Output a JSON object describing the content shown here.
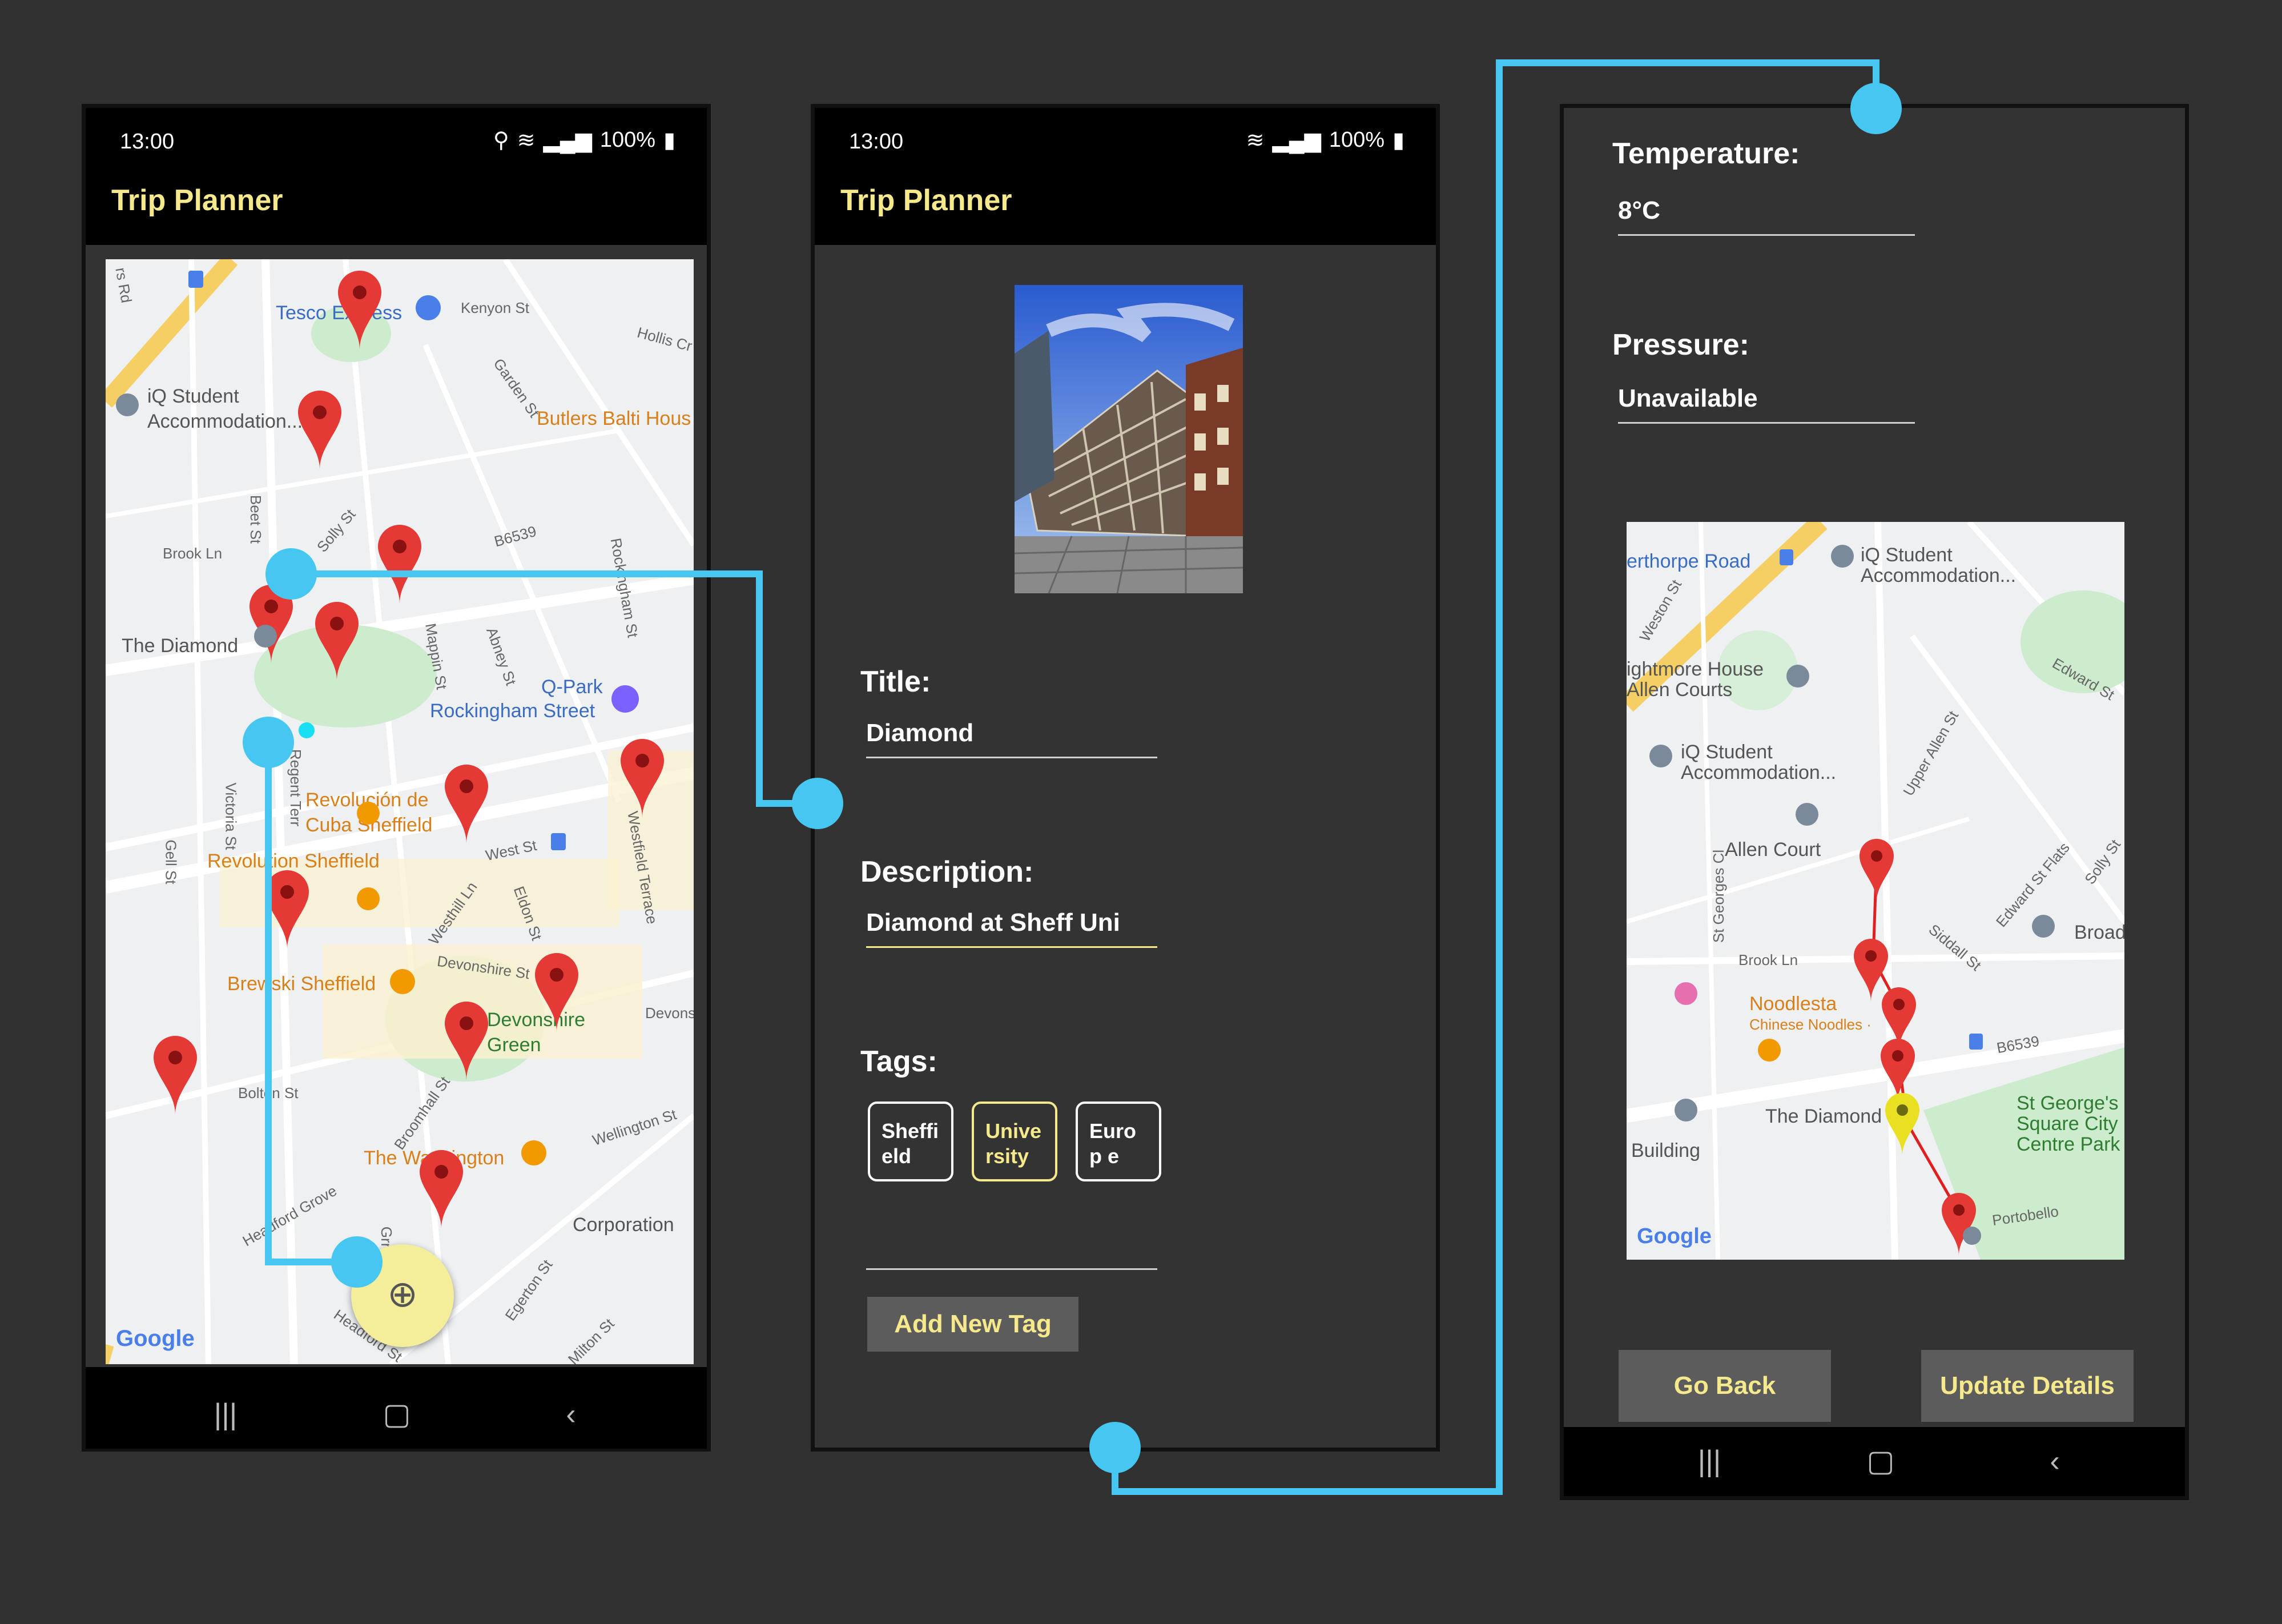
{
  "screen1": {
    "time": "13:00",
    "battery": "100%",
    "app_title": "Trip Planner",
    "map_labels": {
      "tesco": "Tesco Express",
      "kenyon": "Kenyon St",
      "hollis": "Hollis Cr",
      "iq": "iQ Student\nAccommodation...",
      "butlers": "Butlers Balti Hous",
      "garden": "Garden St",
      "brook": "Brook Ln",
      "solly": "Solly St",
      "b6539": "B6539",
      "beet": "Beet St",
      "diamond": "The Diamond",
      "mappin": "Mappin St",
      "abney": "Abney St",
      "rockingham_st": "Rockingham St",
      "qpark": "Q-Park",
      "rockingham_street": "Rockingham Street",
      "revolucion": "Revolución de\nCuba Sheffield",
      "revolution": "Revolution Sheffield",
      "westst": "West St",
      "westfield": "Westfield Terrace",
      "westhill": "Westhill Ln",
      "eldon": "Eldon St",
      "devonshire_st": "Devonshire St",
      "devonshire_green": "Devonshire\nGreen",
      "brewski": "Brewski Sheffield",
      "devons": "Devons",
      "bolton": "Bolton St",
      "broomhall": "Broomhall St",
      "wellington_st": "Wellington St",
      "washington": "The Washington",
      "headford_grove": "Headford Grove",
      "corporation": "Corporation",
      "egerton": "Egerton St",
      "milton": "Milton St",
      "headford_st": "Headford St",
      "victoria": "Victoria St",
      "regent": "Regent Terr",
      "gell": "Gell St",
      "rsrd": "rs Rd",
      "grn": "Grn",
      "google": "Google"
    }
  },
  "screen2": {
    "time": "13:00",
    "battery": "100%",
    "app_title": "Trip Planner",
    "title_label": "Title:",
    "title_value": "Diamond",
    "description_label": "Description:",
    "description_value": "Diamond at Sheff Uni",
    "tags_label": "Tags:",
    "tags": [
      "Sheffi eld",
      "Unive rsity",
      "Europ e"
    ],
    "new_tag_value": "",
    "add_tag_button": "Add New Tag"
  },
  "screen3": {
    "temperature_label": "Temperature:",
    "temperature_value": "8°C",
    "pressure_label": "Pressure:",
    "pressure_value": "Unavailable",
    "map_labels": {
      "netherthorpe": "erthorpe Road",
      "iq1": "iQ Student\nAccommodation...",
      "weston": "Weston St",
      "edward": "Edward St",
      "brightmore": "ightmore House\nAllen Courts",
      "iq2": "iQ Student\nAccommodation...",
      "upper_allen": "Upper Allen St",
      "allen_court": "Allen Court",
      "st_georges_cl": "St Georges Cl",
      "edward_flats": "Edward St Flats",
      "solly": "Solly St",
      "broad": "Broad L",
      "siddall": "Siddall St",
      "brook": "Brook Ln",
      "noodlesta": "Noodlesta",
      "chinese": "Chinese Noodles ·",
      "b6539": "B6539",
      "diamond": "The Diamond",
      "st_georges": "St George's\nSquare City\nCentre Park",
      "building": "Building",
      "portobello": "Portobello",
      "google": "Google"
    },
    "back_button": "Go Back",
    "update_button": "Update Details"
  },
  "colors": {
    "background": "#313131",
    "accent_yellow": "#f5e98c",
    "connector_blue": "#45c7f2",
    "pin_red": "#e53935"
  }
}
